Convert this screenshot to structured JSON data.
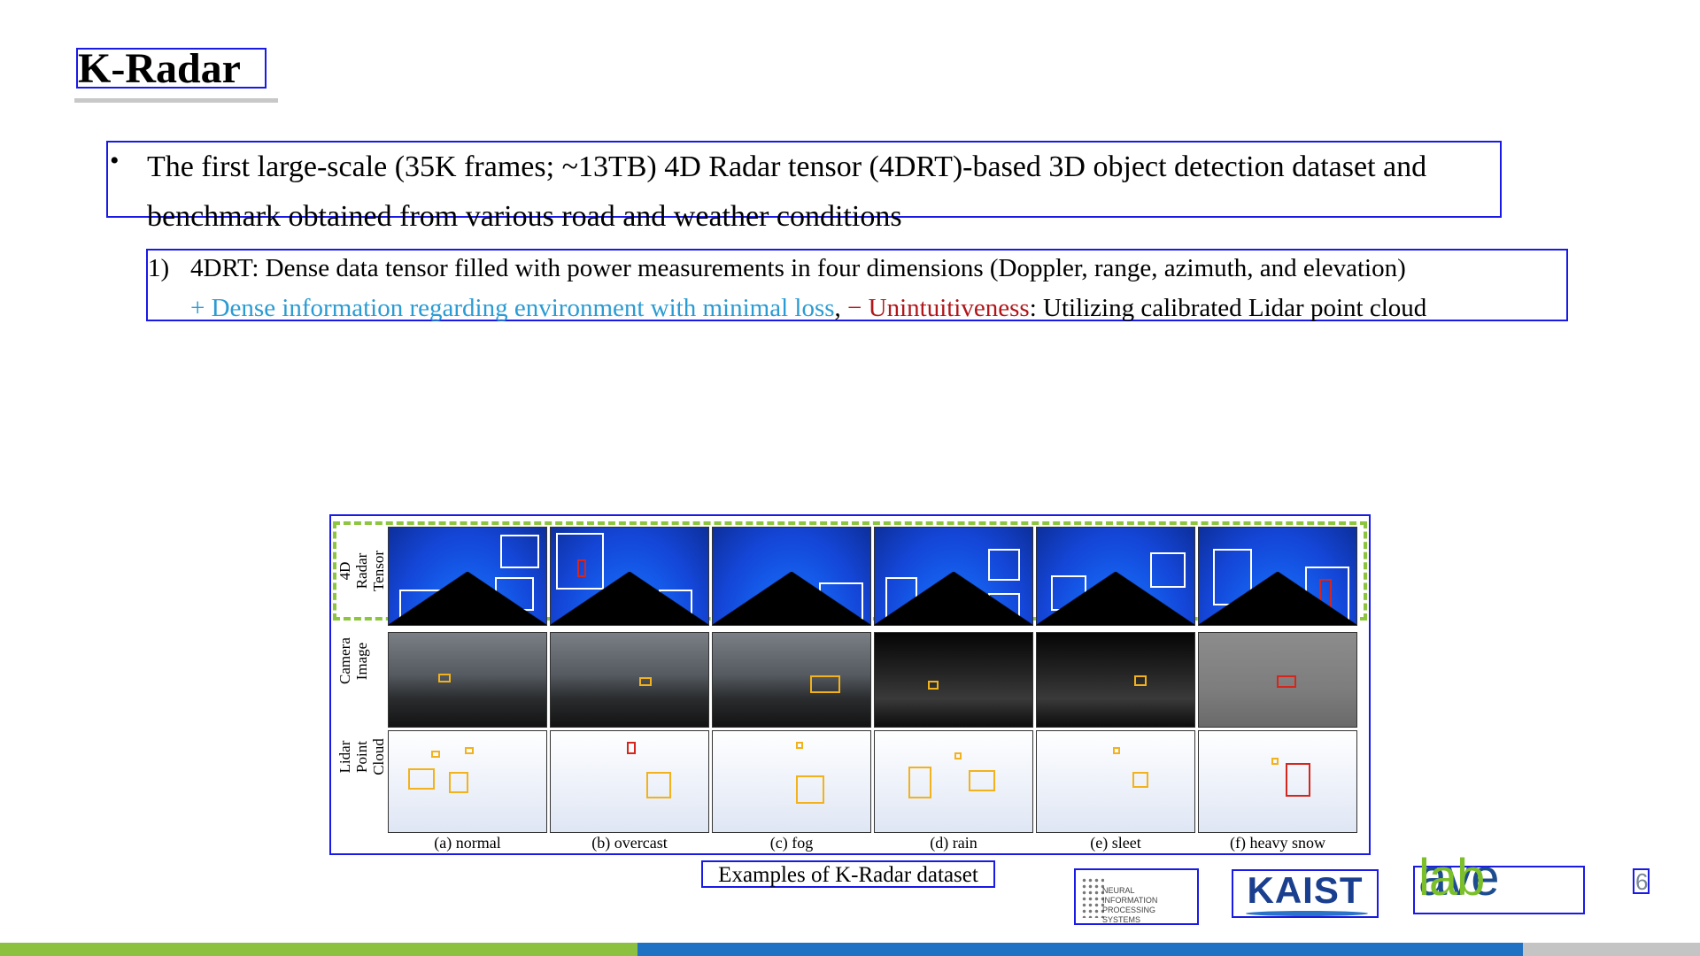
{
  "slide": {
    "title": "K-Radar",
    "bullet": "The first large-scale (35K frames; ~13TB) 4D Radar tensor (4DRT)-based 3D object detection dataset and benchmark obtained from various road and weather conditions",
    "sub_number": "1)",
    "sub_line1": "4DRT: Dense data tensor filled with power measurements in four dimensions (Doppler, range, azimuth, and elevation)",
    "sub_plus": "+ Dense information regarding environment with minimal loss",
    "sub_comma": ",",
    "sub_minus": "− Unintuitiveness",
    "sub_rest": ": Utilizing calibrated Lidar point cloud",
    "page_number": "6"
  },
  "figure": {
    "row_labels": [
      "4D Radar Tensor",
      "Camera Image",
      "Lidar Point Cloud"
    ],
    "conditions": [
      "(a) normal",
      "(b) overcast",
      "(c) fog",
      "(d) rain",
      "(e) sleet",
      "(f) heavy snow"
    ],
    "caption": "Examples of K-Radar dataset"
  },
  "logos": {
    "neurips": "NEURAL INFORMATION PROCESSING SYSTEMS",
    "kaist": "KAIST",
    "avelab_ave": "ave",
    "avelab_lab": "lab"
  },
  "colors": {
    "plus": "#2a9bd3",
    "minus": "#b0161a",
    "bar_green": "#8cc03f",
    "bar_blue": "#1f72c3",
    "bar_gray": "#c4c4c4"
  }
}
